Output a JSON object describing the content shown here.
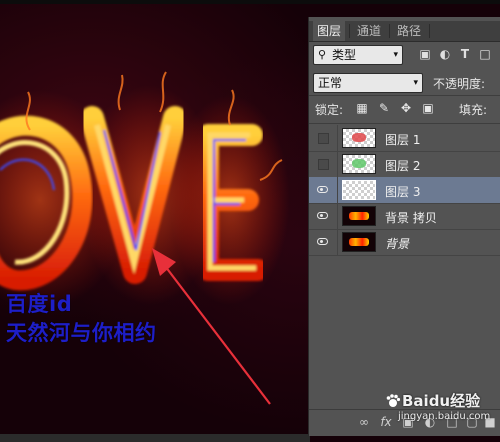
{
  "canvas": {
    "overlay_line1": "百度id",
    "overlay_line2": "天然河与你相约"
  },
  "panel": {
    "tabs": [
      {
        "label": "图层",
        "active": true
      },
      {
        "label": "通道",
        "active": false
      },
      {
        "label": "路径",
        "active": false
      }
    ],
    "filter_select": "类型",
    "blend_mode": "正常",
    "opacity_label": "不透明度:",
    "lock_label": "锁定:",
    "fill_label": "填充:",
    "layers": [
      {
        "name": "图层 1",
        "visible": false,
        "selected": false,
        "thumb": "checker-red",
        "italic": false
      },
      {
        "name": "图层 2",
        "visible": false,
        "selected": false,
        "thumb": "checker-green",
        "italic": false
      },
      {
        "name": "图层 3",
        "visible": true,
        "selected": true,
        "thumb": "checker",
        "italic": false
      },
      {
        "name": "背景 拷贝",
        "visible": true,
        "selected": false,
        "thumb": "fire",
        "italic": false
      },
      {
        "name": "背景",
        "visible": true,
        "selected": false,
        "thumb": "fire",
        "italic": true
      }
    ]
  },
  "watermark": {
    "text": "Baidu经验",
    "sub": "jingyan.baidu.com"
  },
  "colors": {
    "overlay_text": "#1e1ec8",
    "selected_layer": "#6c7a92",
    "panel_bg": "#535353",
    "arrow": "#e8303a"
  }
}
